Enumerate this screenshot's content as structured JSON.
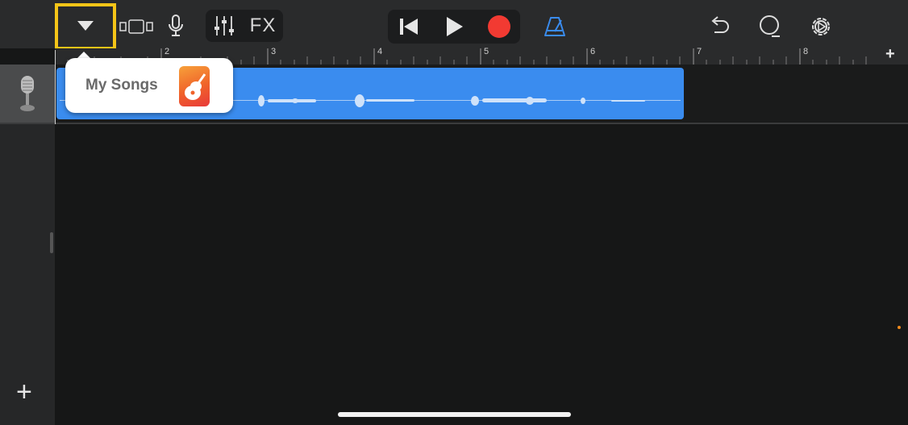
{
  "toolbar": {
    "fx_label": "FX",
    "accent_color": "#3a8cef",
    "record_color": "#f23a32",
    "highlight_color": "#f5c518"
  },
  "popup": {
    "label": "My Songs"
  },
  "ruler": {
    "bars": [
      "2",
      "3",
      "4",
      "5",
      "6",
      "7",
      "8"
    ],
    "add_label": "+"
  },
  "sidebar": {
    "add_track_label": "+"
  },
  "icons": [
    "chevron-down-icon",
    "browser-view-icon",
    "microphone-icon",
    "mixer-icon",
    "rewind-icon",
    "play-icon",
    "record-icon",
    "metronome-icon",
    "undo-icon",
    "loop-icon",
    "settings-icon",
    "garageband-app-icon"
  ]
}
